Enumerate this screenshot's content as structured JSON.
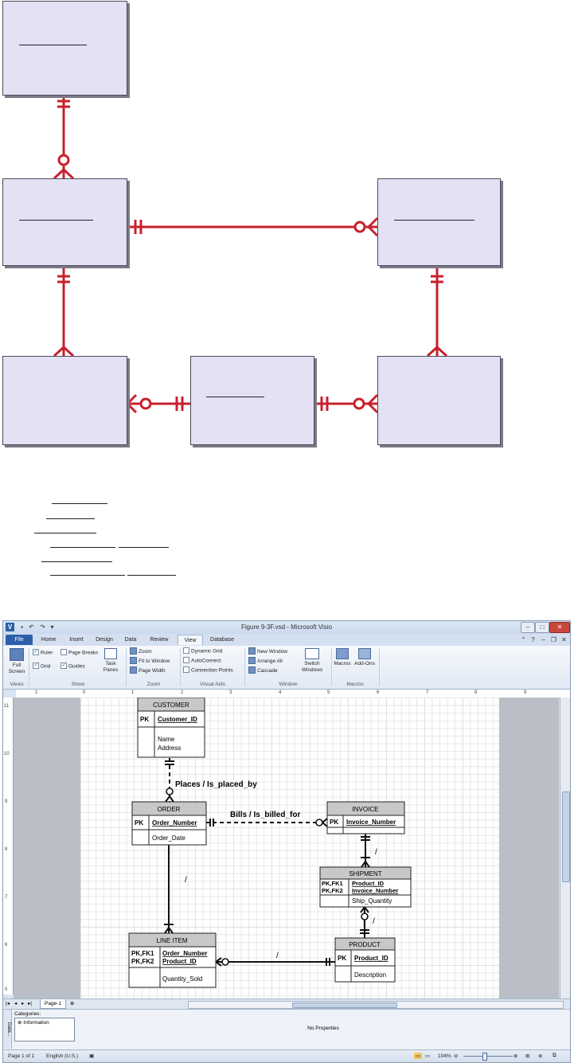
{
  "visio": {
    "title": "Figure 9-3F.vsd - Microsoft Visio",
    "tabs": [
      "File",
      "Home",
      "Insert",
      "Design",
      "Data",
      "Review",
      "View",
      "Database"
    ],
    "active_tab": "View",
    "ribbon": {
      "views": {
        "full_screen": "Full\nScreen",
        "group": "Views"
      },
      "show": {
        "ruler": "Ruler",
        "page_breaks": "Page Breaks",
        "grid": "Grid",
        "guides": "Guides",
        "task_panes": "Task\nPanes",
        "group": "Show"
      },
      "zoom": {
        "zoom": "Zoom",
        "fit_to_window": "Fit to Window",
        "page_width": "Page Width",
        "group": "Zoom"
      },
      "visual_aids": {
        "dynamic_grid": "Dynamic Grid",
        "autoconnect": "AutoConnect",
        "connection_points": "Connection Points",
        "group": "Visual Aids"
      },
      "window": {
        "new_window": "New Window",
        "arrange_all": "Arrange All",
        "cascade": "Cascade",
        "switch_windows": "Switch\nWindows",
        "group": "Window"
      },
      "macros": {
        "macros": "Macros",
        "add_ons": "Add-Ons",
        "group": "Macros"
      }
    },
    "ruler_top_labels": [
      "1",
      "0",
      "1",
      "2",
      "3",
      "4",
      "5",
      "6",
      "7",
      "8",
      "9"
    ],
    "ruler_left_labels": [
      "11",
      "10",
      "9",
      "8",
      "7",
      "6",
      "5"
    ],
    "diagram": {
      "customer": {
        "name": "CUSTOMER",
        "pk": "PK",
        "key": "Customer_ID",
        "attrs": [
          "Name",
          "Address"
        ]
      },
      "order": {
        "name": "ORDER",
        "pk": "PK",
        "key": "Order_Number",
        "attrs": [
          "Order_Date"
        ]
      },
      "invoice": {
        "name": "INVOICE",
        "pk": "PK",
        "key": "Invoice_Number"
      },
      "shipment": {
        "name": "SHIPMENT",
        "pk1": "PK,FK1",
        "pk2": "PK,FK2",
        "key1": "Product_ID",
        "key2": "Invoice_Number",
        "attrs": [
          "Ship_Quantity"
        ]
      },
      "line_item": {
        "name": "LINE ITEM",
        "pk1": "PK,FK1",
        "pk2": "PK,FK2",
        "key1": "Order_Number",
        "key2": "Product_ID",
        "attrs": [
          "Quantity_Sold"
        ]
      },
      "product": {
        "name": "PRODUCT",
        "pk": "PK",
        "key": "Product_ID",
        "attrs": [
          "Description"
        ]
      },
      "rel_places": "Places / Is_placed_by",
      "rel_bills": "Bills / Is_billed_for",
      "rel_slash": "/"
    },
    "page_tab": "Page-1",
    "data_panel": {
      "vertical_label": "Data...",
      "categories_label": "Categories:",
      "category_item": "Information",
      "no_properties": "No Properties"
    },
    "status": {
      "page": "Page 1 of 1",
      "language": "English (U.S.)",
      "zoom": "104%"
    }
  },
  "colors": {
    "relationship_line": "#c8202e",
    "entity_fill": "#e3e1f3",
    "title_fill": "#c8c8c8",
    "file_tab": "#2c5fa8"
  }
}
